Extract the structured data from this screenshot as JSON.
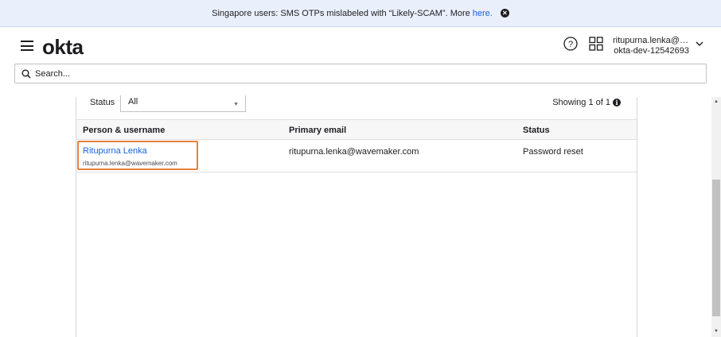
{
  "banner": {
    "text": "Singapore users: SMS OTPs mislabeled with “Likely-SCAM”. More",
    "link": "here.",
    "close_icon": "close-circle-icon"
  },
  "header": {
    "logo": "okta",
    "menu_icon": "hamburger-menu-icon",
    "help_icon": "help-circle-icon",
    "apps_icon": "app-grid-icon",
    "user_email": "ritupurna.lenka@w...",
    "org": "okta-dev-12542693",
    "dropdown_icon": "chevron-down-icon"
  },
  "search": {
    "placeholder": "Search...",
    "icon": "search-icon"
  },
  "filter": {
    "label": "Status",
    "selected": "All",
    "showing": "Showing 1 of 1"
  },
  "table": {
    "columns": [
      "Person & username",
      "Primary email",
      "Status"
    ],
    "rows": [
      {
        "name": "Ritupurna Lenka",
        "username": "ritupurna.lenka@wavemaker.com",
        "email": "ritupurna.lenka@wavemaker.com",
        "status": "Password reset"
      }
    ]
  },
  "colors": {
    "link": "#1662dd",
    "highlight": "#e8813a",
    "banner_bg": "#eaf0fb"
  }
}
